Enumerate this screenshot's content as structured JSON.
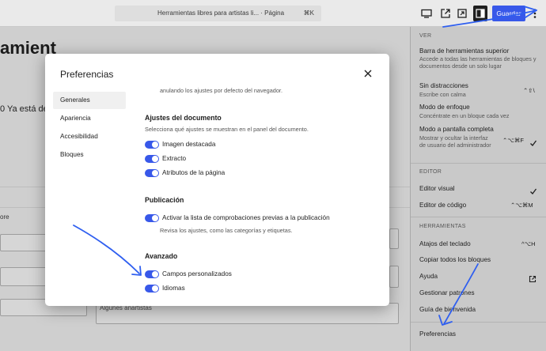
{
  "topbar": {
    "command_title": "Herramientas libres para artistas li... · Página",
    "command_shortcut": "⌘K",
    "save_label": "Guardar"
  },
  "background": {
    "title": "amient",
    "subtitle": "0 Ya está de",
    "column_label": "ore",
    "box_text": "Algunes anartistas"
  },
  "menu": {
    "ver_header": "VER",
    "items_ver": [
      {
        "label": "Barra de herramientas superior",
        "desc": "Accede a todas las herramientas de bloques y documentos desde un solo lugar"
      },
      {
        "label": "Sin distracciones",
        "desc": "Escribe con calma",
        "shortcut": "⌃⇧\\"
      },
      {
        "label": "Modo de enfoque",
        "desc": "Concéntrate en un bloque cada vez"
      },
      {
        "label": "Modo a pantalla completa",
        "desc": "Mostrar y ocultar la interfaz de usuario del administrador",
        "shortcut": "⌃⌥⌘F"
      }
    ],
    "editor_header": "EDITOR",
    "items_editor": [
      {
        "label": "Editor visual"
      },
      {
        "label": "Editor de código",
        "shortcut": "⌃⌥⌘M"
      }
    ],
    "tools_header": "HERRAMIENTAS",
    "items_tools": [
      {
        "label": "Atajos del teclado",
        "shortcut": "^⌥H"
      },
      {
        "label": "Copiar todos los bloques"
      },
      {
        "label": "Ayuda"
      },
      {
        "label": "Gestionar patrones"
      },
      {
        "label": "Guía de bienvenida"
      }
    ],
    "preferences": "Preferencias"
  },
  "modal": {
    "title": "Preferencias",
    "tabs": [
      "Generales",
      "Apariencia",
      "Accesibilidad",
      "Bloques"
    ],
    "top_fade_text": "anulando los ajustes por defecto del navegador.",
    "sections": {
      "document": {
        "heading": "Ajustes del documento",
        "desc": "Selecciona qué ajustes se muestran en el panel del documento.",
        "toggles": [
          "Imagen destacada",
          "Extracto",
          "Atributos de la página"
        ]
      },
      "publish": {
        "heading": "Publicación",
        "toggle": "Activar la lista de comprobaciones previas a la publicación",
        "help": "Revisa los ajustes, como las categorías y etiquetas."
      },
      "advanced": {
        "heading": "Avanzado",
        "toggles": [
          "Campos personalizados",
          "Idiomas"
        ]
      }
    }
  },
  "colors": {
    "accent": "#3858e9",
    "annotation": "#2f5ff0"
  }
}
